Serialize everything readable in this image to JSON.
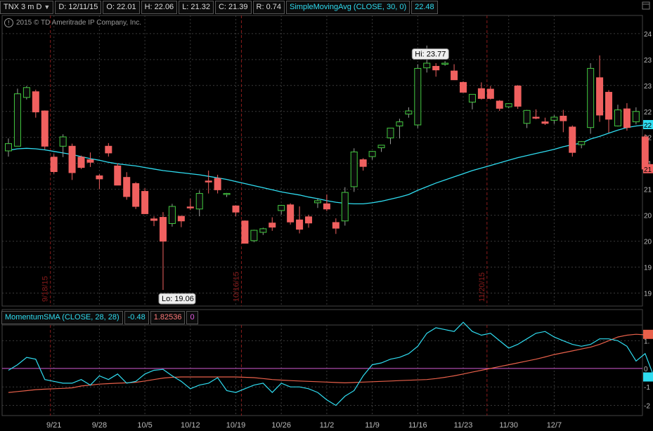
{
  "header": {
    "symbol": "TNX 3 m D",
    "date": "D: 12/11/15",
    "open": "O: 22.01",
    "high": "H: 22.06",
    "low": "L: 21.32",
    "close": "C: 21.39",
    "range": "R: 0.74",
    "study": "SimpleMovingAvg (CLOSE, 30, 0)",
    "study_value": "22.48"
  },
  "copyright": "2015 © TD Ameritrade IP Company, Inc.",
  "lower_header": {
    "study": "MomentumSMA (CLOSE, 28, 28)",
    "value1": "-0.48",
    "value2": "1.82536",
    "value3": "0"
  },
  "colors": {
    "up": "#41c93e",
    "down": "#f0605f",
    "sma": "#2fdcf0",
    "signal": "#e8604a",
    "zero": "#d35bd3",
    "grid": "#3a3a3a",
    "divider": "#8a1c1c"
  },
  "chart_data": [
    {
      "type": "candlestick",
      "title": "TNX 3 m D",
      "y_tick_labels": [
        "24",
        "23",
        "23",
        "22",
        "22",
        "21",
        "21",
        "20",
        "20",
        "19",
        "19"
      ],
      "price_tags": [
        "22",
        "21"
      ],
      "x_tick_labels": [
        "9/21",
        "9/28",
        "10/5",
        "10/12",
        "10/19",
        "10/26",
        "11/2",
        "11/9",
        "11/16",
        "11/23",
        "11/30",
        "12/7"
      ],
      "divider_labels": [
        "9/18/15",
        "10/16/15",
        "11/20/15"
      ],
      "annotations": {
        "hi": "Hi: 23.77",
        "lo": "Lo: 19.06"
      },
      "ylim": [
        18.75,
        24.35
      ],
      "candles": [
        {
          "o": 21.74,
          "h": 21.98,
          "l": 21.63,
          "c": 21.88
        },
        {
          "o": 21.83,
          "h": 22.94,
          "l": 21.83,
          "c": 22.84
        },
        {
          "o": 22.77,
          "h": 22.99,
          "l": 22.73,
          "c": 22.96
        },
        {
          "o": 22.88,
          "h": 22.92,
          "l": 22.38,
          "c": 22.49
        },
        {
          "o": 22.51,
          "h": 22.52,
          "l": 21.77,
          "c": 21.83
        },
        {
          "o": 21.62,
          "h": 21.68,
          "l": 21.3,
          "c": 21.34
        },
        {
          "o": 21.83,
          "h": 22.06,
          "l": 21.62,
          "c": 22.01
        },
        {
          "o": 21.83,
          "h": 21.88,
          "l": 21.18,
          "c": 21.32
        },
        {
          "o": 21.62,
          "h": 21.65,
          "l": 21.39,
          "c": 21.42
        },
        {
          "o": 21.57,
          "h": 21.71,
          "l": 21.43,
          "c": 21.52
        },
        {
          "o": 21.26,
          "h": 21.29,
          "l": 21.0,
          "c": 21.2
        },
        {
          "o": 21.83,
          "h": 21.89,
          "l": 21.63,
          "c": 21.7
        },
        {
          "o": 21.45,
          "h": 21.5,
          "l": 21.1,
          "c": 21.08
        },
        {
          "o": 21.23,
          "h": 21.33,
          "l": 20.8,
          "c": 20.86
        },
        {
          "o": 21.11,
          "h": 21.14,
          "l": 20.62,
          "c": 20.67
        },
        {
          "o": 20.96,
          "h": 21.02,
          "l": 20.52,
          "c": 20.53
        },
        {
          "o": 20.43,
          "h": 20.48,
          "l": 20.29,
          "c": 20.4
        },
        {
          "o": 20.46,
          "h": 20.56,
          "l": 19.06,
          "c": 20.0
        },
        {
          "o": 20.34,
          "h": 20.72,
          "l": 20.28,
          "c": 20.67
        },
        {
          "o": 20.48,
          "h": 20.49,
          "l": 20.27,
          "c": 20.39
        },
        {
          "o": 20.66,
          "h": 20.82,
          "l": 20.6,
          "c": 20.64
        },
        {
          "o": 20.62,
          "h": 20.98,
          "l": 20.48,
          "c": 20.92
        },
        {
          "o": 21.16,
          "h": 21.36,
          "l": 20.92,
          "c": 21.14
        },
        {
          "o": 21.21,
          "h": 21.28,
          "l": 20.92,
          "c": 20.99
        },
        {
          "o": 20.92,
          "h": 20.93,
          "l": 20.85,
          "c": 20.92
        },
        {
          "o": 20.68,
          "h": 20.69,
          "l": 20.48,
          "c": 20.56
        },
        {
          "o": 20.39,
          "h": 20.4,
          "l": 19.97,
          "c": 19.96
        },
        {
          "o": 20.01,
          "h": 20.22,
          "l": 19.98,
          "c": 20.21
        },
        {
          "o": 20.17,
          "h": 20.26,
          "l": 20.12,
          "c": 20.24
        },
        {
          "o": 20.35,
          "h": 20.46,
          "l": 20.2,
          "c": 20.27
        },
        {
          "o": 20.59,
          "h": 20.7,
          "l": 20.51,
          "c": 20.69
        },
        {
          "o": 20.7,
          "h": 20.73,
          "l": 20.32,
          "c": 20.37
        },
        {
          "o": 20.41,
          "h": 20.67,
          "l": 20.15,
          "c": 20.23
        },
        {
          "o": 20.47,
          "h": 20.51,
          "l": 20.26,
          "c": 20.35
        },
        {
          "o": 20.74,
          "h": 20.82,
          "l": 20.64,
          "c": 20.78
        },
        {
          "o": 20.72,
          "h": 20.9,
          "l": 20.58,
          "c": 20.62
        },
        {
          "o": 20.36,
          "h": 20.44,
          "l": 20.14,
          "c": 20.25
        },
        {
          "o": 20.39,
          "h": 21.04,
          "l": 20.3,
          "c": 20.94
        },
        {
          "o": 21.05,
          "h": 21.79,
          "l": 20.95,
          "c": 21.72
        },
        {
          "o": 21.57,
          "h": 21.6,
          "l": 21.36,
          "c": 21.44
        },
        {
          "o": 21.63,
          "h": 21.74,
          "l": 21.57,
          "c": 21.73
        },
        {
          "o": 21.8,
          "h": 21.85,
          "l": 21.72,
          "c": 21.85
        },
        {
          "o": 21.99,
          "h": 22.13,
          "l": 21.87,
          "c": 22.18
        },
        {
          "o": 22.22,
          "h": 22.36,
          "l": 21.98,
          "c": 22.3
        },
        {
          "o": 22.45,
          "h": 22.58,
          "l": 22.38,
          "c": 22.51
        },
        {
          "o": 22.24,
          "h": 23.41,
          "l": 22.18,
          "c": 23.33
        },
        {
          "o": 23.34,
          "h": 23.77,
          "l": 23.25,
          "c": 23.43
        },
        {
          "o": 23.37,
          "h": 23.43,
          "l": 23.17,
          "c": 23.3
        },
        {
          "o": 23.43,
          "h": 23.47,
          "l": 23.38,
          "c": 23.43
        },
        {
          "o": 23.28,
          "h": 23.41,
          "l": 23.11,
          "c": 23.11
        },
        {
          "o": 23.06,
          "h": 23.08,
          "l": 22.86,
          "c": 22.87
        },
        {
          "o": 22.68,
          "h": 22.72,
          "l": 22.54,
          "c": 22.83
        },
        {
          "o": 22.94,
          "h": 23.06,
          "l": 22.73,
          "c": 22.75
        },
        {
          "o": 22.93,
          "h": 22.99,
          "l": 22.73,
          "c": 22.75
        },
        {
          "o": 22.7,
          "h": 22.72,
          "l": 22.51,
          "c": 22.56
        },
        {
          "o": 22.59,
          "h": 22.66,
          "l": 22.56,
          "c": 22.65
        },
        {
          "o": 22.99,
          "h": 23.01,
          "l": 22.55,
          "c": 22.6
        },
        {
          "o": 22.27,
          "h": 22.53,
          "l": 22.18,
          "c": 22.52
        },
        {
          "o": 22.39,
          "h": 22.54,
          "l": 22.35,
          "c": 22.37
        },
        {
          "o": 22.3,
          "h": 22.38,
          "l": 22.24,
          "c": 22.27
        },
        {
          "o": 22.33,
          "h": 22.43,
          "l": 22.26,
          "c": 22.39
        },
        {
          "o": 22.41,
          "h": 22.53,
          "l": 22.1,
          "c": 22.32
        },
        {
          "o": 22.2,
          "h": 22.23,
          "l": 21.63,
          "c": 21.71
        },
        {
          "o": 21.86,
          "h": 21.93,
          "l": 21.79,
          "c": 21.92
        },
        {
          "o": 22.19,
          "h": 23.43,
          "l": 22.07,
          "c": 23.33
        },
        {
          "o": 23.15,
          "h": 23.58,
          "l": 22.3,
          "c": 22.43
        },
        {
          "o": 22.87,
          "h": 22.91,
          "l": 22.09,
          "c": 22.35
        },
        {
          "o": 22.22,
          "h": 22.63,
          "l": 22.21,
          "c": 22.53
        },
        {
          "o": 22.55,
          "h": 22.66,
          "l": 22.13,
          "c": 22.19
        },
        {
          "o": 22.3,
          "h": 22.58,
          "l": 22.25,
          "c": 22.5
        },
        {
          "o": 22.01,
          "h": 22.06,
          "l": 21.32,
          "c": 21.39
        }
      ],
      "sma_values": [
        21.75,
        21.78,
        21.79,
        21.78,
        21.76,
        21.73,
        21.7,
        21.67,
        21.63,
        21.59,
        21.56,
        21.52,
        21.49,
        21.47,
        21.45,
        21.42,
        21.39,
        21.36,
        21.34,
        21.32,
        21.3,
        21.28,
        21.25,
        21.22,
        21.19,
        21.15,
        21.11,
        21.07,
        21.03,
        20.99,
        20.95,
        20.92,
        20.89,
        20.85,
        20.82,
        20.78,
        20.75,
        20.73,
        20.72,
        20.72,
        20.74,
        20.77,
        20.81,
        20.85,
        20.9,
        20.98,
        21.05,
        21.12,
        21.18,
        21.24,
        21.3,
        21.36,
        21.41,
        21.46,
        21.51,
        21.56,
        21.61,
        21.65,
        21.69,
        21.73,
        21.77,
        21.82,
        21.86,
        21.89,
        21.97,
        22.02,
        22.08,
        22.14,
        22.19,
        22.22,
        22.24
      ]
    },
    {
      "type": "line",
      "title": "MomentumSMA (CLOSE, 28, 28)",
      "y_tick_labels": [
        "1.",
        "0",
        "-1",
        "-2"
      ],
      "ylim": [
        -2.55,
        2.35
      ],
      "series": [
        {
          "name": "MomentumSMA",
          "color": "#2fdcf0",
          "values": [
            -0.1,
            0.2,
            0.6,
            0.5,
            -0.6,
            -0.7,
            -0.8,
            -0.8,
            -0.6,
            -0.9,
            -0.4,
            -0.6,
            -0.3,
            -0.8,
            -0.7,
            -0.3,
            -0.1,
            -0.05,
            -0.4,
            -0.7,
            -1.1,
            -0.9,
            -0.8,
            -0.5,
            -1.2,
            -1.3,
            -1.1,
            -0.9,
            -0.8,
            -1.3,
            -0.8,
            -1.0,
            -1.0,
            -1.1,
            -1.3,
            -1.7,
            -2.0,
            -1.5,
            -1.2,
            -0.4,
            0.2,
            0.3,
            0.5,
            0.6,
            0.8,
            1.2,
            1.9,
            2.2,
            2.1,
            2.0,
            2.5,
            2.0,
            1.8,
            1.9,
            1.5,
            1.1,
            1.3,
            1.6,
            1.9,
            2.0,
            1.7,
            1.5,
            1.3,
            1.2,
            1.3,
            1.6,
            1.6,
            1.5,
            1.2,
            0.4,
            0.8,
            -0.48
          ]
        },
        {
          "name": "signal",
          "color": "#e8604a",
          "values": [
            -1.3,
            -1.25,
            -1.2,
            -1.15,
            -1.12,
            -1.1,
            -1.08,
            -1.05,
            -0.95,
            -0.9,
            -0.85,
            -0.82,
            -0.8,
            -0.78,
            -0.75,
            -0.68,
            -0.6,
            -0.52,
            -0.48,
            -0.46,
            -0.46,
            -0.46,
            -0.46,
            -0.46,
            -0.46,
            -0.46,
            -0.48,
            -0.5,
            -0.55,
            -0.6,
            -0.63,
            -0.66,
            -0.68,
            -0.7,
            -0.72,
            -0.74,
            -0.76,
            -0.78,
            -0.76,
            -0.74,
            -0.72,
            -0.7,
            -0.68,
            -0.66,
            -0.64,
            -0.62,
            -0.6,
            -0.55,
            -0.48,
            -0.4,
            -0.3,
            -0.2,
            -0.1,
            0.0,
            0.1,
            0.2,
            0.3,
            0.4,
            0.5,
            0.62,
            0.75,
            0.85,
            0.95,
            1.05,
            1.15,
            1.3,
            1.5,
            1.7,
            1.8,
            1.85,
            1.82,
            1.82536
          ]
        },
        {
          "name": "zero",
          "color": "#d35bd3",
          "values": [
            0
          ]
        }
      ]
    }
  ]
}
